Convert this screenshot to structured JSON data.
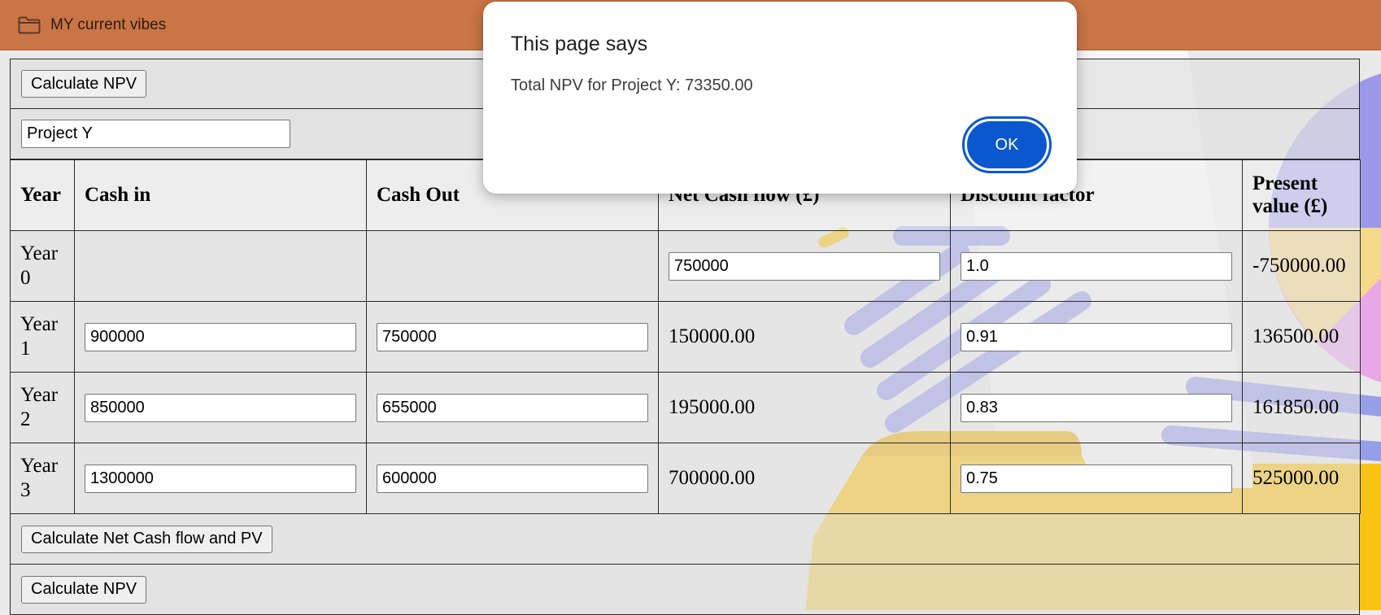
{
  "topbar": {
    "title": "MY current vibes",
    "icon": "folder-icon"
  },
  "buttons": {
    "calculate_npv": "Calculate NPV",
    "calculate_net_cash_flow_pv": "Calculate Net Cash flow and PV"
  },
  "project_name": {
    "value": "Project Y"
  },
  "table": {
    "headers": [
      "Year",
      "Cash in",
      "Cash Out",
      "Net Cash flow (£)",
      "Discount factor",
      "Present value (£)"
    ],
    "rows": [
      {
        "year": "Year 0",
        "cash_in": "",
        "cash_out": "",
        "net_cash_flow": "750000",
        "discount_factor": "1.0",
        "present_value": "-750000.00"
      },
      {
        "year": "Year 1",
        "cash_in": "900000",
        "cash_out": "750000",
        "net_cash_flow": "150000.00",
        "discount_factor": "0.91",
        "present_value": "136500.00"
      },
      {
        "year": "Year 2",
        "cash_in": "850000",
        "cash_out": "655000",
        "net_cash_flow": "195000.00",
        "discount_factor": "0.83",
        "present_value": "161850.00"
      },
      {
        "year": "Year 3",
        "cash_in": "1300000",
        "cash_out": "600000",
        "net_cash_flow": "700000.00",
        "discount_factor": "0.75",
        "present_value": "525000.00"
      }
    ]
  },
  "dialog": {
    "title": "This page says",
    "message": "Total NPV for Project Y: 73350.00",
    "ok_label": "OK"
  },
  "colors": {
    "topbar": "#c97545",
    "dialog_button": "#0b57d0",
    "decor_blue": "#8f96ea",
    "decor_yellow": "#f8c312",
    "decor_pink": "#e89ce8"
  }
}
